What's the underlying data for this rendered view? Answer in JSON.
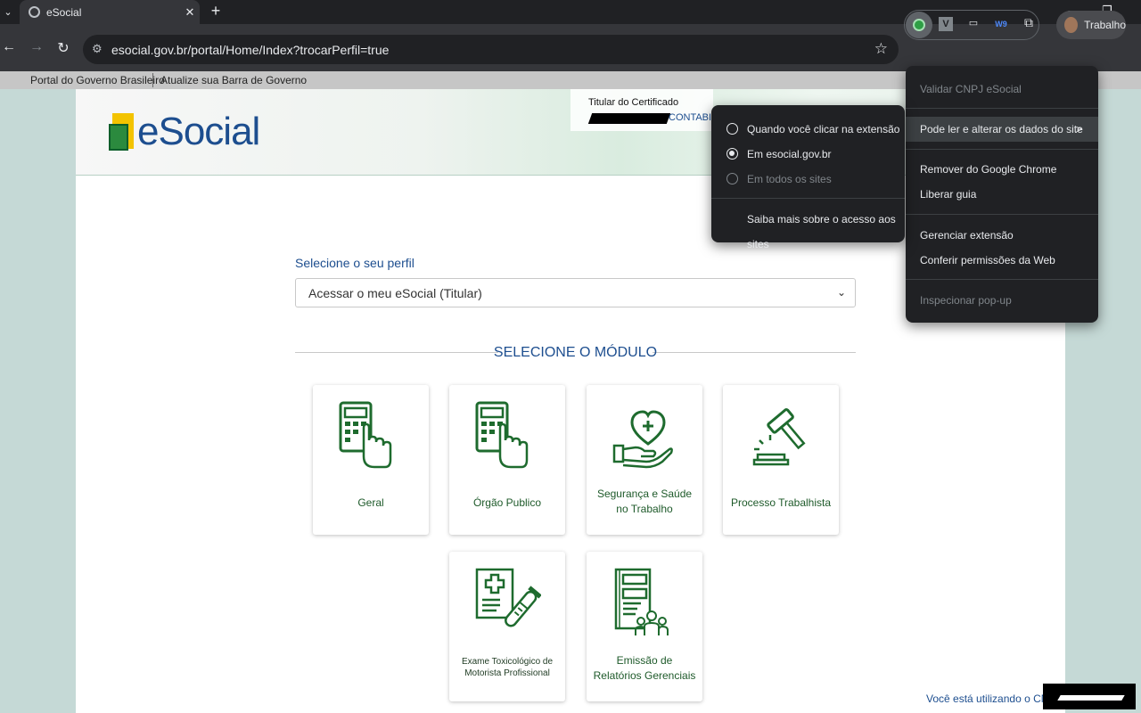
{
  "browser": {
    "tab_title": "eSocial",
    "tab_close": "✕",
    "new_tab": "+",
    "tab_search": "⌄",
    "minimize": "—",
    "restore": "❐",
    "url": "esocial.gov.br/portal/Home/Index?trocarPerfil=true",
    "profile_name": "Trabalho",
    "back": "←",
    "forward": "→",
    "reload": "↻",
    "star": "☆",
    "ext_v": "V",
    "ext_laptop": "▭",
    "ext_w": "W9",
    "ext_puzzle": "⧉"
  },
  "govbar": {
    "portal": "Portal do Governo Brasileiro",
    "atualize": "Atualize sua Barra de Governo"
  },
  "header": {
    "logo_text": "eSocial",
    "cert_title": "Titular do Certificado",
    "cert_name_suffix": "CONTABIL"
  },
  "perfil": {
    "label": "Selecione o seu perfil",
    "selected": "Acessar o meu eSocial (Titular)",
    "chevron": "⌄"
  },
  "modulo": {
    "title": "SELECIONE O MÓDULO",
    "cards": [
      {
        "label": "Geral",
        "icon": "calculator-hand-icon"
      },
      {
        "label": "Órgão Publico",
        "icon": "calculator-hand-icon"
      },
      {
        "label": "Segurança e Saúde no Trabalho",
        "icon": "heart-hand-icon"
      },
      {
        "label": "Processo Trabalhista",
        "icon": "gavel-icon"
      },
      {
        "label": "Exame Toxicológico de Motorista Profissional",
        "icon": "medical-test-icon"
      },
      {
        "label": "Emissão de Relatórios Gerenciais",
        "icon": "report-people-icon"
      }
    ]
  },
  "footer": {
    "cnpj_text": "Você está utilizando o CNPJ"
  },
  "ext_menu": {
    "validar": "Validar CNPJ eSocial",
    "pode_ler": "Pode ler e alterar os dados do site",
    "arrow": ">",
    "remover": "Remover do Google Chrome",
    "liberar": "Liberar guia",
    "gerenciar": "Gerenciar extensão",
    "conferir": "Conferir permissões da Web",
    "inspecionar": "Inspecionar pop-up"
  },
  "sub_menu": {
    "quando": "Quando você clicar na extensão",
    "em_site": "Em esocial.gov.br",
    "todos": "Em todos os sites",
    "saiba": "Saiba mais sobre o acesso aos sites",
    "selected": "Em esocial.gov.br"
  },
  "colors": {
    "brand_blue": "#1d4e8f",
    "icon_green": "#1e6b2e",
    "chrome_dark": "#202124"
  }
}
